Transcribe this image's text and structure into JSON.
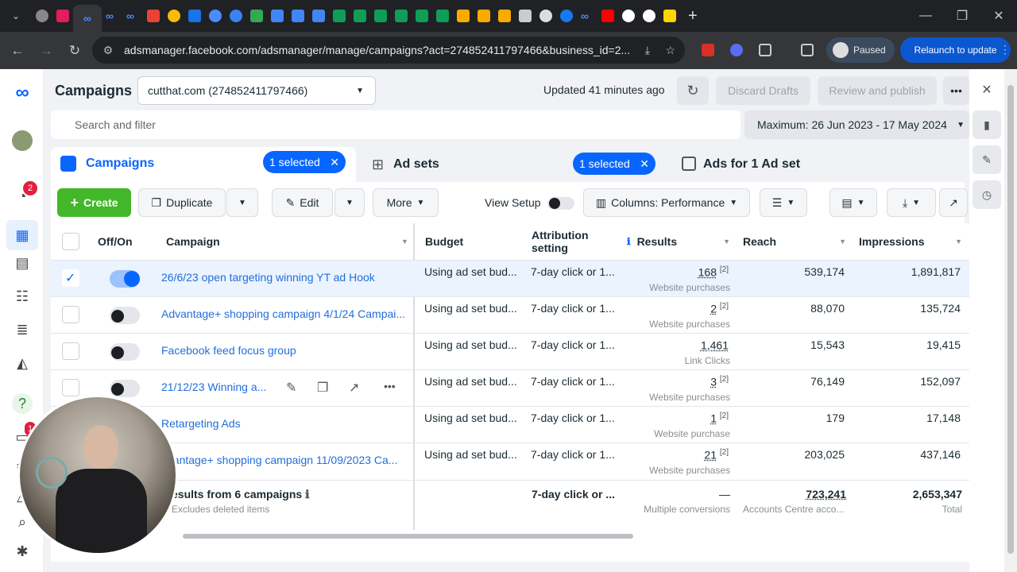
{
  "browser": {
    "url": "adsmanager.facebook.com/adsmanager/manage/campaigns?act=274852411797466&business_id=2...",
    "profile_status": "Paused",
    "relaunch_label": "Relaunch to update"
  },
  "header": {
    "title": "Campaigns",
    "account": "cutthat.com (274852411797466)",
    "updated": "Updated 41 minutes ago",
    "discard_label": "Discard Drafts",
    "review_label": "Review and publish"
  },
  "search": {
    "placeholder": "Search and filter",
    "date_range": "Maximum: 26 Jun 2023 - 17 May 2024"
  },
  "tabs": {
    "campaigns": "Campaigns",
    "campaigns_selected": "1 selected",
    "adsets": "Ad sets",
    "adsets_selected": "1 selected",
    "ads": "Ads for 1 Ad set"
  },
  "toolbar": {
    "create": "Create",
    "duplicate": "Duplicate",
    "edit": "Edit",
    "more": "More",
    "view_setup": "View Setup",
    "columns": "Columns: Performance"
  },
  "columns": [
    "Off/On",
    "Campaign",
    "Budget",
    "Attribution setting",
    "Results",
    "Reach",
    "Impressions"
  ],
  "rows": [
    {
      "name": "26/6/23 open targeting winning YT ad Hook",
      "budget": "Using ad set bud...",
      "attribution": "7-day click or 1...",
      "results": "168",
      "sup": "[2]",
      "result_type": "Website purchases",
      "reach": "539,174",
      "impressions": "1,891,817",
      "checked": true,
      "on": true
    },
    {
      "name": "Advantage+ shopping campaign 4/1/24 Campai...",
      "budget": "Using ad set bud...",
      "attribution": "7-day click or 1...",
      "results": "2",
      "sup": "[2]",
      "result_type": "Website purchases",
      "reach": "88,070",
      "impressions": "135,724",
      "checked": false,
      "on": false
    },
    {
      "name": "Facebook feed focus group",
      "budget": "Using ad set bud...",
      "attribution": "7-day click or 1...",
      "results": "1,461",
      "sup": "",
      "result_type": "Link Clicks",
      "reach": "15,543",
      "impressions": "19,415",
      "checked": false,
      "on": false
    },
    {
      "name": "21/12/23 Winning a...",
      "budget": "Using ad set bud...",
      "attribution": "7-day click or 1...",
      "results": "3",
      "sup": "[2]",
      "result_type": "Website purchases",
      "reach": "76,149",
      "impressions": "152,097",
      "checked": false,
      "on": false
    },
    {
      "name": "Retargeting Ads",
      "budget": "Using ad set bud...",
      "attribution": "7-day click or 1...",
      "results": "1",
      "sup": "[2]",
      "result_type": "Website purchase",
      "reach": "179",
      "impressions": "17,148",
      "checked": false,
      "on": false
    },
    {
      "name": "dvantage+ shopping campaign 11/09/2023 Ca...",
      "budget": "Using ad set bud...",
      "attribution": "7-day click or 1...",
      "results": "21",
      "sup": "[2]",
      "result_type": "Website purchases",
      "reach": "203,025",
      "impressions": "437,146",
      "checked": false,
      "on": false
    }
  ],
  "totals": {
    "label": "esults from 6 campaigns",
    "sub": "Excludes deleted items",
    "attribution": "7-day click or ...",
    "results": "—",
    "results_sub": "Multiple conversions",
    "reach": "723,241",
    "reach_sub": "Accounts Centre acco...",
    "impressions": "2,653,347",
    "impressions_sub": "Total"
  },
  "badges": {
    "notifications": "2",
    "other": "1"
  },
  "colors": {
    "accent": "#0866ff",
    "create_green": "#42b72a",
    "selected_pill": "#0866ff"
  }
}
